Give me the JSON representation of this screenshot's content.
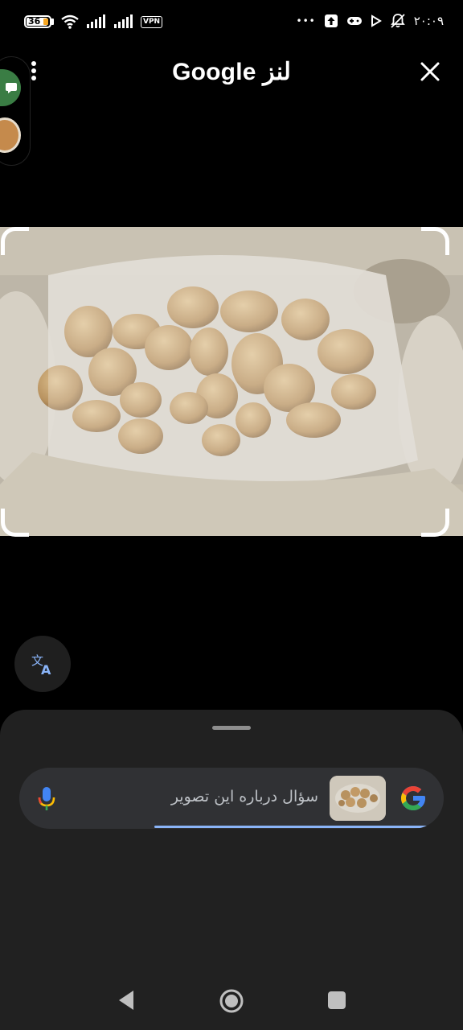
{
  "status_bar": {
    "battery_level": "36",
    "vpn_label": "VPN",
    "overflow_label": "•••",
    "time": "۲۰:۰۹"
  },
  "header": {
    "title": "Google لنز",
    "menu_icon": "more-vert-icon",
    "close_icon": "close-icon"
  },
  "image": {
    "description_icon": "selected-photo"
  },
  "sheet": {
    "search_placeholder": "سؤال درباره این تصویر",
    "mic_icon": "mic-icon",
    "google_icon": "google-g-icon"
  },
  "colors": {
    "accent_underline": "#8ab4f8",
    "sheet_bg": "#212121",
    "search_bg": "#303134"
  },
  "nav": {
    "back_icon": "back-icon",
    "home_icon": "home-icon",
    "recents_icon": "recents-icon"
  }
}
